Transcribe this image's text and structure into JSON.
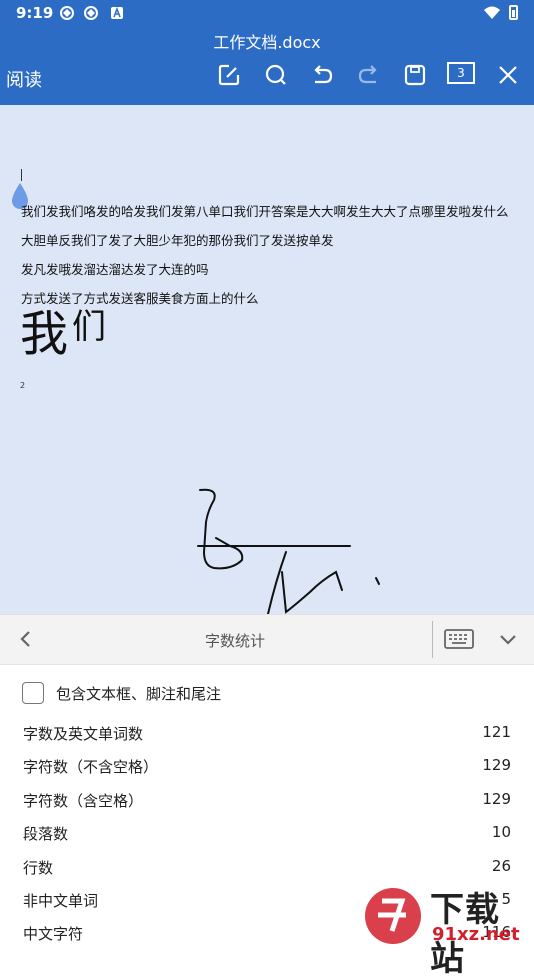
{
  "status_bar": {
    "time": "9:19",
    "icons": [
      "location-icon",
      "location-icon",
      "a-badge-icon",
      "wifi-icon",
      "battery-icon"
    ]
  },
  "app_bar": {
    "file_name": "工作文档.docx",
    "mode_label": "阅读",
    "page_count": "3",
    "icons": [
      "edit-icon",
      "search-icon",
      "undo-icon",
      "redo-icon",
      "save-icon",
      "page-count-icon",
      "close-icon"
    ]
  },
  "document": {
    "lines": [
      "我们发我们咯发的哈发我们发第八单口我们开答案是大大啊发生大大了点哪里发啦发什么",
      "大胆单反我们了发了大胆少年犯的那份我们了发送按单发",
      "发凡发哦发溜达溜达发了大连的吗",
      "方式发送了方式发送客服美食方面上的什么"
    ],
    "big_text": "我",
    "big_text_sup": "们",
    "page_number": "2"
  },
  "panel": {
    "title": "字数统计",
    "option_label": "包含文本框、脚注和尾注",
    "option_checked": false,
    "stats": [
      {
        "label": "字数及英文单词数",
        "value": "121"
      },
      {
        "label": "字符数（不含空格）",
        "value": "129"
      },
      {
        "label": "字符数（含空格）",
        "value": "129"
      },
      {
        "label": "段落数",
        "value": "10"
      },
      {
        "label": "行数",
        "value": "26"
      },
      {
        "label": "非中文单词",
        "value": "5"
      },
      {
        "label": "中文字符",
        "value": "116"
      }
    ]
  },
  "watermark": {
    "line1": "下载站",
    "line2": "91xz.net"
  },
  "colors": {
    "app_bar": "#2d6cc4",
    "document_bg": "#dde6f7",
    "panel_bar": "#f3f3f3",
    "watermark_red": "#d31f2b"
  }
}
